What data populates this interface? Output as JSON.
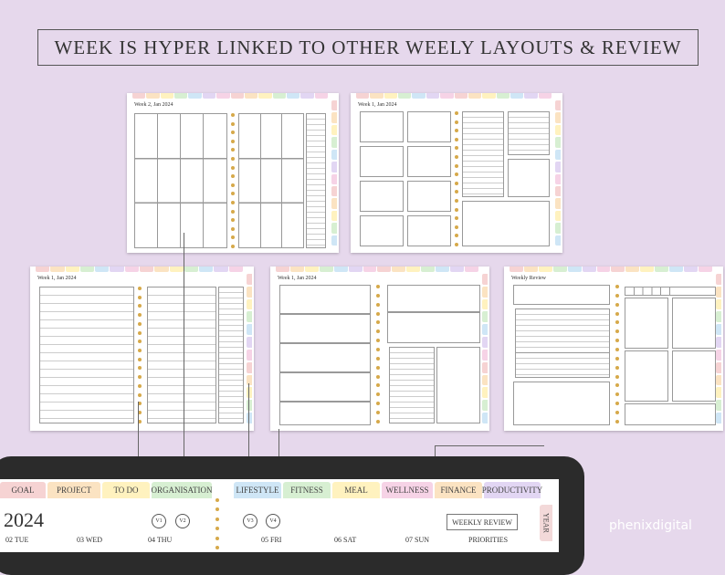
{
  "headline": "WEEK IS HYPER LINKED TO OTHER WEELY LAYOUTS & REVIEW",
  "pages": [
    {
      "title": "Week 2, Jan 2024"
    },
    {
      "title": "Week 1, Jan 2024"
    },
    {
      "title": "Week 1, Jan 2024"
    },
    {
      "title": "Week 1, Jan 2024"
    },
    {
      "title": "Weekly Review"
    }
  ],
  "tab_colors": [
    "#f6d3d3",
    "#fbe3c2",
    "#fff2bf",
    "#d7efd2",
    "#cfe6f6",
    "#e2d6f3",
    "#f6d3e6"
  ],
  "tablet": {
    "tabs": [
      "GOAL",
      "PROJECT",
      "TO DO",
      "ORGANISATION",
      "LIFESTYLE",
      "FITNESS",
      "MEAL",
      "WELLNESS",
      "FINANCE",
      "PRODUCTIVITY"
    ],
    "year": "2024",
    "weekly_review": "WEEKLY REVIEW",
    "year_tab": "YEAR",
    "days": [
      "02 TUE",
      "03 WED",
      "04 THU",
      "05 FRI",
      "06 SAT",
      "07 SUN"
    ],
    "priorities": "PRIORITIES",
    "links": [
      "V1",
      "V2",
      "V3",
      "V4"
    ]
  },
  "brand": "phenixdigital"
}
